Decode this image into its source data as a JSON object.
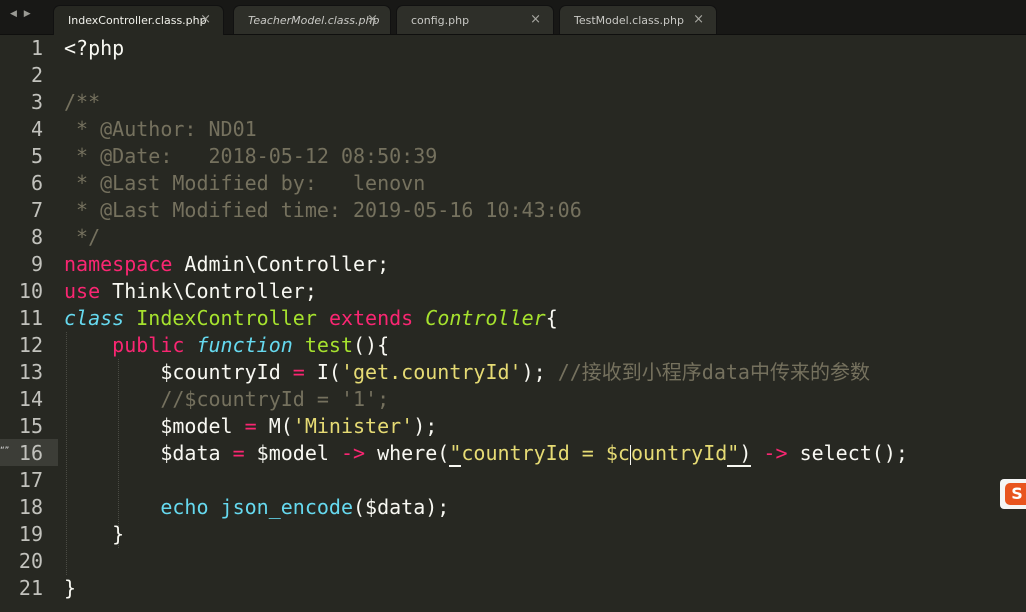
{
  "tabs": [
    {
      "label": "IndexController.class.php",
      "close": "×",
      "active": true,
      "italic": false
    },
    {
      "label": "TeacherModel.class.php",
      "close": "×",
      "active": false,
      "italic": true
    },
    {
      "label": "config.php",
      "close": "×",
      "active": false,
      "italic": false
    },
    {
      "label": "TestModel.class.php",
      "close": "×",
      "active": false,
      "italic": false
    }
  ],
  "nav": {
    "arrows": "◀ ▶"
  },
  "line_numbers": [
    "1",
    "2",
    "3",
    "4",
    "5",
    "6",
    "7",
    "8",
    "9",
    "10",
    "11",
    "12",
    "13",
    "14",
    "15",
    "16",
    "17",
    "18",
    "19",
    "20",
    "21"
  ],
  "current_line": "16",
  "code": {
    "l1": "<?php",
    "l3": "/**",
    "l4": " * @Author: ND01",
    "l5": " * @Date:   2018-05-12 08:50:39",
    "l6": " * @Last Modified by:   lenovn",
    "l7": " * @Last Modified time: 2019-05-16 10:43:06",
    "l8": " */",
    "l9_kw": "namespace",
    "l9_rest": " Admin\\Controller;",
    "l10_kw": "use",
    "l10_rest": " Think\\Controller;",
    "l11_class": "class",
    "l11_name": "IndexController",
    "l11_extends": "extends",
    "l11_parent": "Controller",
    "l11_brace": "{",
    "l12_public": "public",
    "l12_function": "function",
    "l12_name": "test",
    "l12_rest": "(){",
    "l13_var": "$countryId",
    "l13_eq": " = ",
    "l13_fn": "I(",
    "l13_str": "'get.countryId'",
    "l13_close": ");",
    "l13_comment": " //接收到小程序data中传来的参数",
    "l14_comment": "//$countryId = '1';",
    "l15_var": "$model",
    "l15_eq": " = ",
    "l15_fn": "M(",
    "l15_str": "'Minister'",
    "l15_close": ");",
    "l16_var": "$data",
    "l16_eq": " = ",
    "l16_obj": "$model",
    "l16_arrow1": " -> ",
    "l16_where": "where(",
    "l16_q1": "\"",
    "l16_str_a": "countryId = $c",
    "l16_str_b": "ountryId",
    "l16_q2": "\"",
    "l16_paren": ")",
    "l16_arrow2": " -> ",
    "l16_select": "select();",
    "l18_echo": "echo",
    "l18_fn": "json_encode",
    "l18_rest": "($data);",
    "l19": "}",
    "l21": "}"
  },
  "side_badge": {
    "letter": "S"
  },
  "left_fragment": "“”"
}
